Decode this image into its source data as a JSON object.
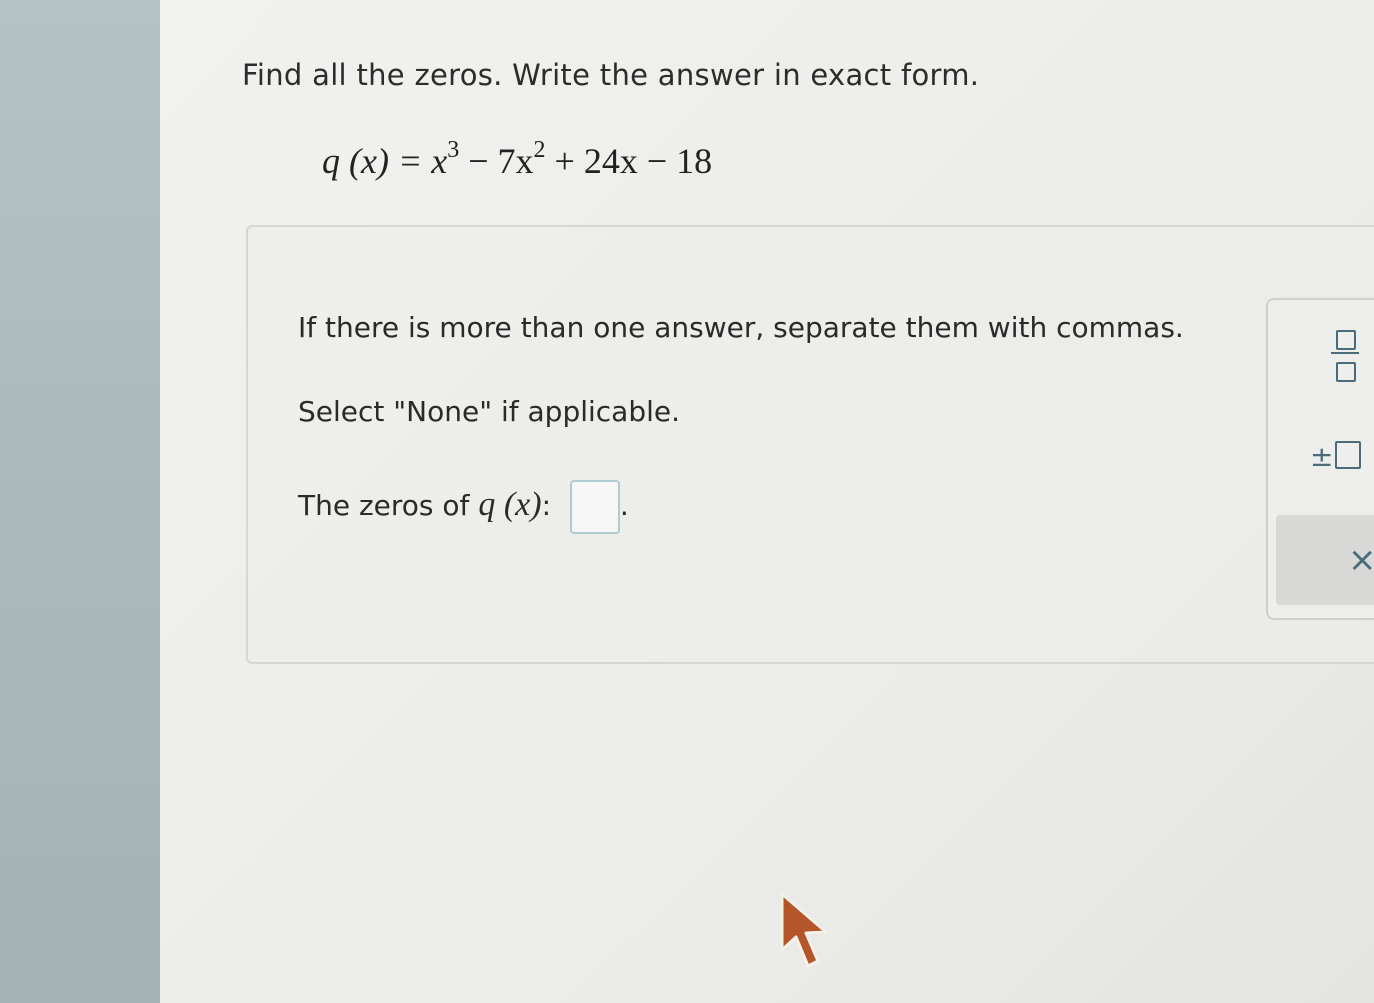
{
  "problem": {
    "title": "Find all the zeros. Write the answer in exact form.",
    "equation": {
      "lhs": "q (x) =",
      "x1": "x",
      "exp3": "3",
      "mid": " − 7x",
      "exp2": "2",
      "tail": " + 24x − 18"
    }
  },
  "instructions": {
    "line1": "If there is more than one answer, separate them with commas.",
    "line2": "Select \"None\" if applicable.",
    "zeros_prefix": "The zeros of ",
    "zeros_fn": "q (x)",
    "zeros_colon": ":",
    "answer_value": "",
    "period": "."
  },
  "toolbar": {
    "pm_symbol": "±",
    "close_symbol": "×"
  },
  "colors": {
    "accent": "#4a6b78",
    "input_border": "#aecbd0",
    "cursor": "#b4552a"
  }
}
